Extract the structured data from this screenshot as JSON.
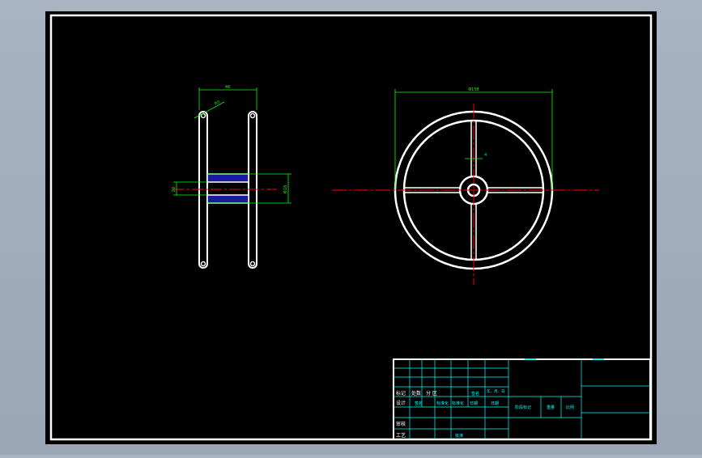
{
  "drawing": {
    "side_view": {
      "dim_width": "48",
      "dim_rim": "R5",
      "dim_hub_width": "20",
      "dim_hub_diameter": "Φ18"
    },
    "front_view": {
      "dim_outer_diameter": "Φ158",
      "dim_spoke": "4"
    }
  },
  "title_block": {
    "header_row": [
      "标记",
      "处数",
      "分 区",
      "",
      "",
      "签名",
      "年、月、日"
    ],
    "design_row": [
      "设计",
      "",
      "标准化",
      "",
      "日期",
      "标准化",
      "签名",
      "日期"
    ],
    "stage_labels": [
      "阶段标记",
      "重量",
      "比例"
    ],
    "review_label": "审核",
    "process_label": "工艺",
    "approve_label": "批准"
  },
  "colors": {
    "background": "#000000",
    "geometry": "#ffffff",
    "dimension": "#00ff00",
    "centerline": "#ff0000",
    "title_block": "#00ffff",
    "hub_fill": "#1a1aa0"
  }
}
